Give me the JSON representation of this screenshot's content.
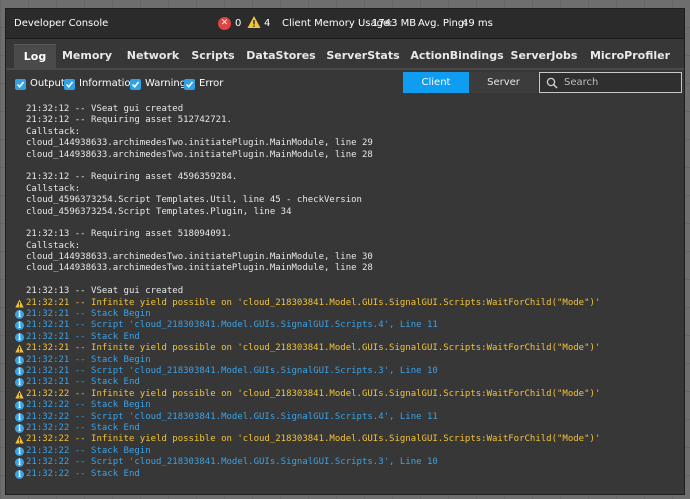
{
  "window": {
    "title": "Developer Console",
    "error_count": "0",
    "warning_count": "4",
    "memory_label": "Client Memory Usage:",
    "memory_value": "1743 MB",
    "ping_label": "Avg. Ping:",
    "ping_value": "49 ms"
  },
  "tabs": [
    {
      "label": "Log",
      "active": true
    },
    {
      "label": "Memory"
    },
    {
      "label": "Network"
    },
    {
      "label": "Scripts"
    },
    {
      "label": "DataStores"
    },
    {
      "label": "ServerStats"
    },
    {
      "label": "ActionBindings"
    },
    {
      "label": "ServerJobs"
    },
    {
      "label": "MicroProfiler"
    }
  ],
  "filters": [
    {
      "label": "Output",
      "checked": true
    },
    {
      "label": "Information",
      "checked": true
    },
    {
      "label": "Warning",
      "checked": true
    },
    {
      "label": "Error",
      "checked": true
    }
  ],
  "toggle": {
    "client": "Client",
    "server": "Server",
    "selected": "Client"
  },
  "search": {
    "placeholder": "Search"
  },
  "colors": {
    "accent": "#0f9df2",
    "warning": "#f2c33a",
    "info": "#3aa3e8",
    "error": "#e04343"
  },
  "log": [
    {
      "type": "out",
      "text": "21:32:12 -- VSeat gui created"
    },
    {
      "type": "out",
      "text": "21:32:12 -- Requiring asset 512742721."
    },
    {
      "type": "out",
      "text": "Callstack:"
    },
    {
      "type": "out",
      "text": "cloud_144938633.archimedesTwo.initiatePlugin.MainModule, line 29"
    },
    {
      "type": "out",
      "text": "cloud_144938633.archimedesTwo.initiatePlugin.MainModule, line 28"
    },
    {
      "type": "out",
      "text": ""
    },
    {
      "type": "out",
      "text": "21:32:12 -- Requiring asset 4596359284."
    },
    {
      "type": "out",
      "text": "Callstack:"
    },
    {
      "type": "out",
      "text": "cloud_4596373254.Script Templates.Util, line 45 - checkVersion"
    },
    {
      "type": "out",
      "text": "cloud_4596373254.Script Templates.Plugin, line 34"
    },
    {
      "type": "out",
      "text": ""
    },
    {
      "type": "out",
      "text": "21:32:13 -- Requiring asset 518094091."
    },
    {
      "type": "out",
      "text": "Callstack:"
    },
    {
      "type": "out",
      "text": "cloud_144938633.archimedesTwo.initiatePlugin.MainModule, line 30"
    },
    {
      "type": "out",
      "text": "cloud_144938633.archimedesTwo.initiatePlugin.MainModule, line 28"
    },
    {
      "type": "out",
      "text": ""
    },
    {
      "type": "out",
      "text": "21:32:13 -- VSeat gui created"
    },
    {
      "type": "warn",
      "text": "21:32:21 -- Infinite yield possible on 'cloud_218303841.Model.GUIs.SignalGUI.Scripts:WaitForChild(\"Mode\")'"
    },
    {
      "type": "info",
      "text": "21:32:21 -- Stack Begin"
    },
    {
      "type": "info",
      "text": "21:32:21 -- Script 'cloud_218303841.Model.GUIs.SignalGUI.Scripts.4', Line 11"
    },
    {
      "type": "info",
      "text": "21:32:21 -- Stack End"
    },
    {
      "type": "warn",
      "text": "21:32:21 -- Infinite yield possible on 'cloud_218303841.Model.GUIs.SignalGUI.Scripts:WaitForChild(\"Mode\")'"
    },
    {
      "type": "info",
      "text": "21:32:21 -- Stack Begin"
    },
    {
      "type": "info",
      "text": "21:32:21 -- Script 'cloud_218303841.Model.GUIs.SignalGUI.Scripts.3', Line 10"
    },
    {
      "type": "info",
      "text": "21:32:21 -- Stack End"
    },
    {
      "type": "warn",
      "text": "21:32:22 -- Infinite yield possible on 'cloud_218303841.Model.GUIs.SignalGUI.Scripts:WaitForChild(\"Mode\")'"
    },
    {
      "type": "info",
      "text": "21:32:22 -- Stack Begin"
    },
    {
      "type": "info",
      "text": "21:32:22 -- Script 'cloud_218303841.Model.GUIs.SignalGUI.Scripts.4', Line 11"
    },
    {
      "type": "info",
      "text": "21:32:22 -- Stack End"
    },
    {
      "type": "warn",
      "text": "21:32:22 -- Infinite yield possible on 'cloud_218303841.Model.GUIs.SignalGUI.Scripts:WaitForChild(\"Mode\")'"
    },
    {
      "type": "info",
      "text": "21:32:22 -- Stack Begin"
    },
    {
      "type": "info",
      "text": "21:32:22 -- Script 'cloud_218303841.Model.GUIs.SignalGUI.Scripts.3', Line 10"
    },
    {
      "type": "info",
      "text": "21:32:22 -- Stack End"
    }
  ]
}
